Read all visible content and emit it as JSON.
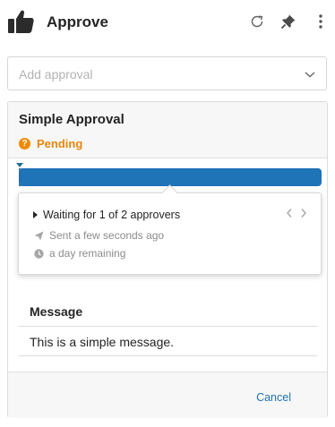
{
  "header": {
    "title": "Approve",
    "icons": [
      "thumbs-up-icon",
      "refresh-icon",
      "pin-icon",
      "more-vertical-icon"
    ]
  },
  "approval_select": {
    "placeholder": "Add approval",
    "icon": "chevron-down-icon"
  },
  "approval": {
    "name": "Simple Approval",
    "status": "Pending",
    "status_icon": "question-icon",
    "progress_percent": 100,
    "popover": {
      "summary": "Waiting for 1 of 2 approvers",
      "sent": "Sent a few seconds ago",
      "remaining": "a day remaining"
    },
    "message_label": "Message",
    "message": "This is a simple message.",
    "cancel_label": "Cancel"
  },
  "colors": {
    "accent": "#1f73b7",
    "pending": "#f08a00",
    "text": "#242424",
    "muted": "#8c8c8c"
  }
}
